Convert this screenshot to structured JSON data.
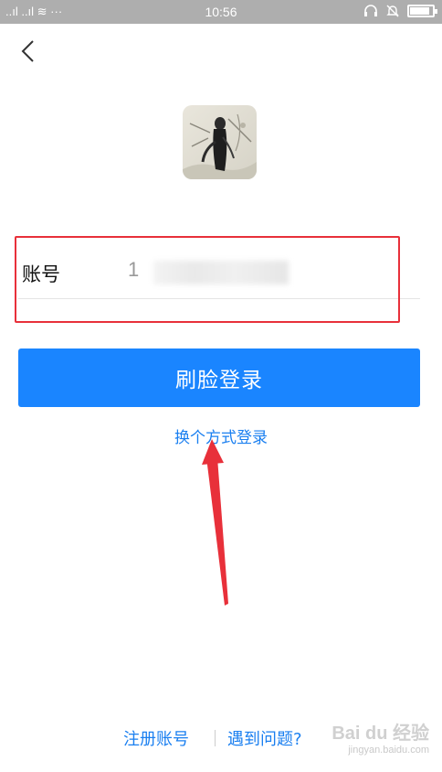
{
  "status_bar": {
    "left_indicators": "..ıl ..ıl ≋ ···",
    "time": "10:56",
    "battery_level": 0.8
  },
  "back": {
    "icon": "chevron-left-icon"
  },
  "avatar": {
    "icon": "avatar-image"
  },
  "account": {
    "label": "账号",
    "value": "1"
  },
  "login_button": {
    "label": "刷脸登录"
  },
  "switch_login": {
    "label": "换个方式登录"
  },
  "footer": {
    "register": "注册账号",
    "help": "遇到问题?"
  },
  "watermark": {
    "brand": "Bai du 经验",
    "url": "jingyan.baidu.com"
  },
  "colors": {
    "accent": "#1a85ff",
    "link": "#1a7ff0",
    "annotation": "#e8303a"
  }
}
